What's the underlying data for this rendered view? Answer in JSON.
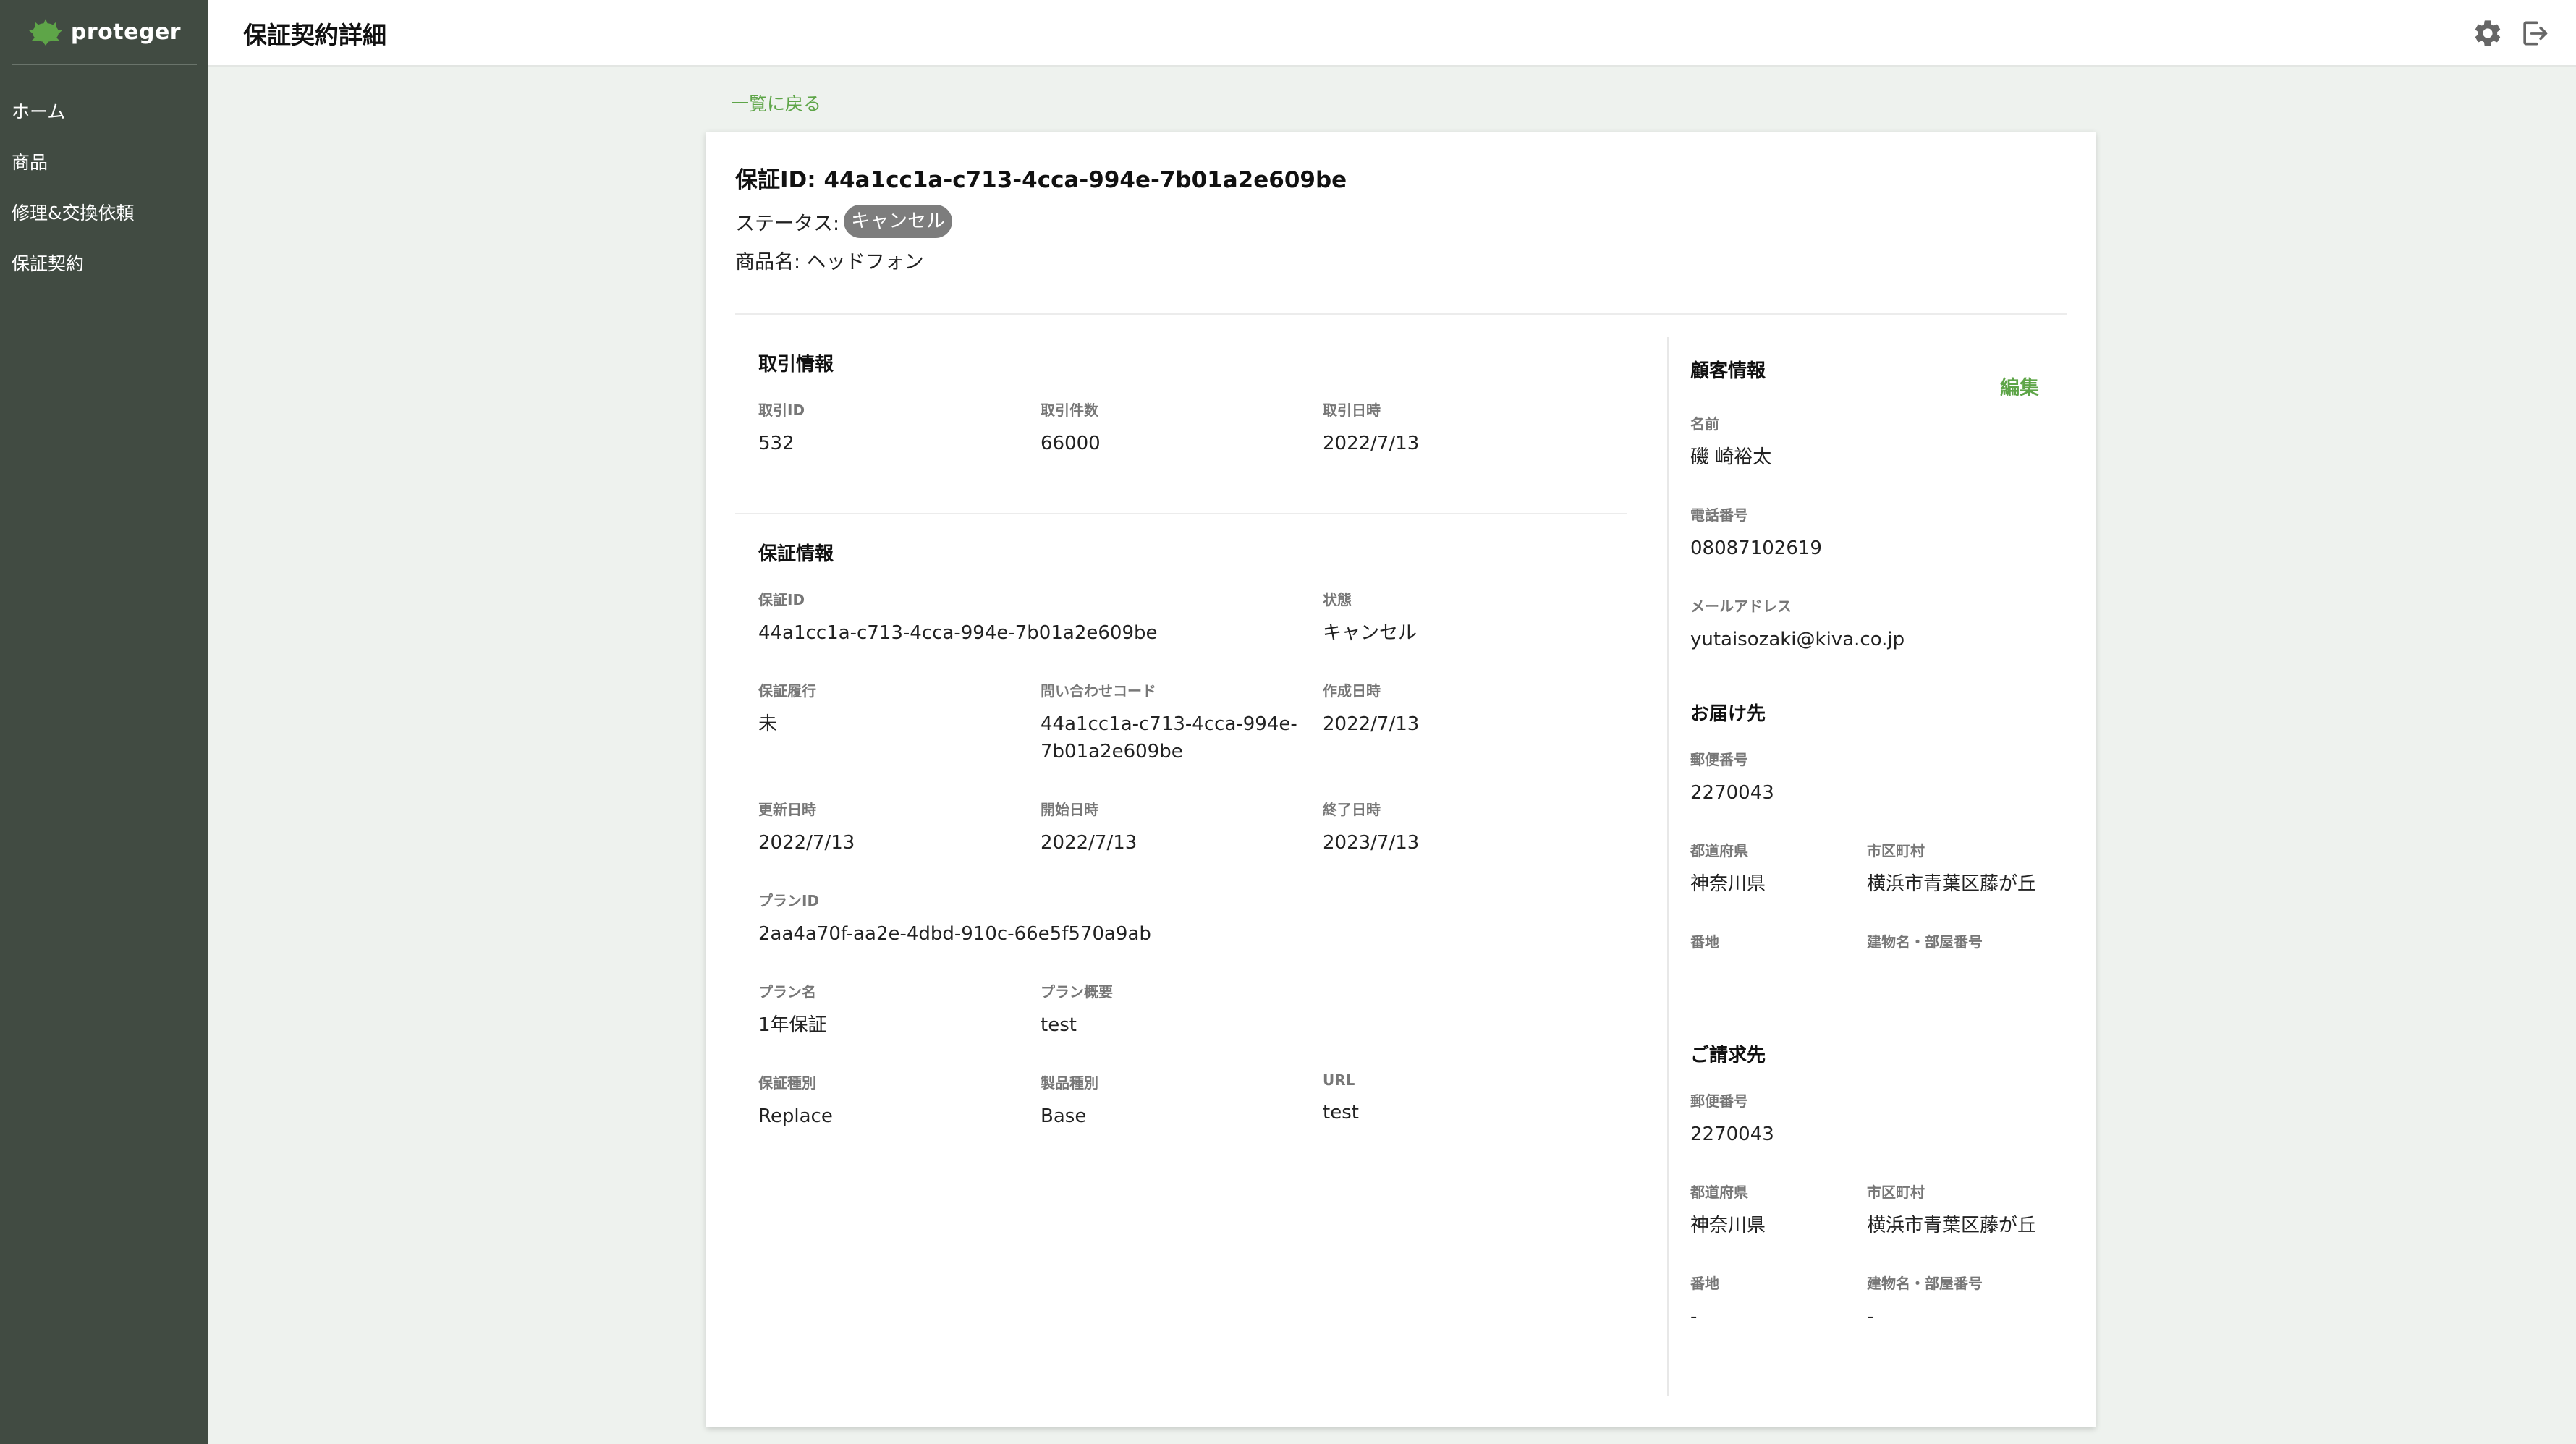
{
  "app": {
    "name": "proteger"
  },
  "sidebar": {
    "items": [
      {
        "label": "ホーム"
      },
      {
        "label": "商品"
      },
      {
        "label": "修理&交換依頼"
      },
      {
        "label": "保証契約"
      }
    ]
  },
  "header": {
    "title": "保証契約詳細"
  },
  "back_link": "一覧に戻る",
  "summary": {
    "warranty_id_line": "保証ID: 44a1cc1a-c713-4cca-994e-7b01a2e609be",
    "status_label": "ステータス:",
    "status_value": "キャンセル",
    "product_line": "商品名: ヘッドフォン"
  },
  "transaction": {
    "title": "取引情報",
    "fields": [
      {
        "label": "取引ID",
        "value": "532"
      },
      {
        "label": "取引件数",
        "value": "66000"
      },
      {
        "label": "取引日時",
        "value": "2022/7/13"
      }
    ]
  },
  "warranty": {
    "title": "保証情報",
    "id": {
      "label": "保証ID",
      "value": "44a1cc1a-c713-4cca-994e-7b01a2e609be"
    },
    "state": {
      "label": "状態",
      "value": "キャンセル"
    },
    "performed": {
      "label": "保証履行",
      "value": "未"
    },
    "inquiry_code": {
      "label": "問い合わせコード",
      "value": "44a1cc1a-c713-4cca-994e-\n7b01a2e609be"
    },
    "created": {
      "label": "作成日時",
      "value": "2022/7/13"
    },
    "updated": {
      "label": "更新日時",
      "value": "2022/7/13"
    },
    "start": {
      "label": "開始日時",
      "value": "2022/7/13"
    },
    "end": {
      "label": "終了日時",
      "value": "2023/7/13"
    },
    "plan_id": {
      "label": "プランID",
      "value": "2aa4a70f-aa2e-4dbd-910c-66e5f570a9ab"
    },
    "plan_name": {
      "label": "プラン名",
      "value": "1年保証"
    },
    "plan_summary": {
      "label": "プラン概要",
      "value": "test"
    },
    "warranty_type": {
      "label": "保証種別",
      "value": "Replace"
    },
    "product_type": {
      "label": "製品種別",
      "value": "Base"
    },
    "url": {
      "label": "URL",
      "value": "test"
    }
  },
  "customer": {
    "title": "顧客情報",
    "edit_label": "編集",
    "name": {
      "label": "名前",
      "value": "磯 崎裕太"
    },
    "phone": {
      "label": "電話番号",
      "value": "08087102619"
    },
    "email": {
      "label": "メールアドレス",
      "value": "yutaisozaki@kiva.co.jp"
    }
  },
  "shipping": {
    "title": "お届け先",
    "postal": {
      "label": "郵便番号",
      "value": "2270043"
    },
    "prefecture": {
      "label": "都道府県",
      "value": "神奈川県"
    },
    "city": {
      "label": "市区町村",
      "value": "横浜市青葉区藤が丘"
    },
    "street": {
      "label": "番地",
      "value": ""
    },
    "building": {
      "label": "建物名・部屋番号",
      "value": ""
    }
  },
  "billing": {
    "title": "ご請求先",
    "postal": {
      "label": "郵便番号",
      "value": "2270043"
    },
    "prefecture": {
      "label": "都道府県",
      "value": "神奈川県"
    },
    "city": {
      "label": "市区町村",
      "value": "横浜市青葉区藤が丘"
    },
    "street": {
      "label": "番地",
      "value": "-"
    },
    "building": {
      "label": "建物名・部屋番号",
      "value": "-"
    }
  },
  "colors": {
    "sidebar": "#414b42",
    "accent": "#5ea548",
    "badge": "#7d7d7d",
    "background": "#eef2ee"
  },
  "icons": {
    "settings": "gear-icon",
    "logout": "logout-icon",
    "logo": "leaf-logo-icon"
  }
}
